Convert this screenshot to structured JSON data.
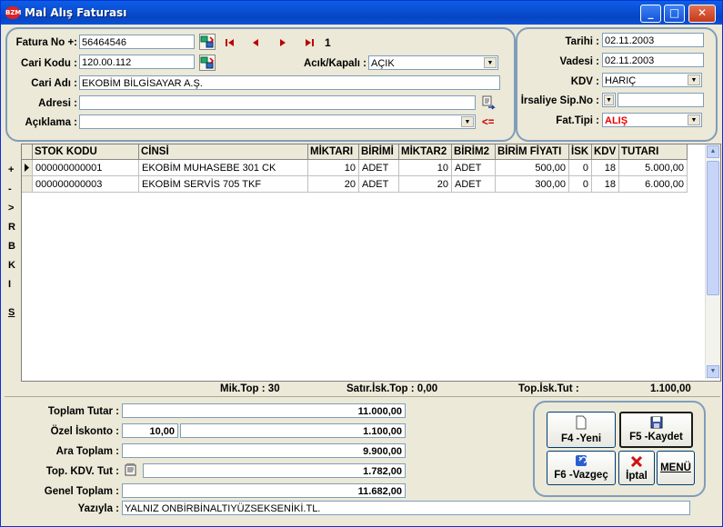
{
  "window": {
    "title": "Mal Alış Faturası",
    "logo_text": "BZM"
  },
  "header": {
    "fatura_no_label": "Fatura No +:",
    "fatura_no": "56464546",
    "nav_record": "1",
    "cari_kodu_label": "Cari Kodu :",
    "cari_kodu": "120.00.112",
    "acik_kapali_label": "Acık/Kapalı :",
    "acik_kapali": "AÇIK",
    "cari_adi_label": "Cari Adı :",
    "cari_adi": "EKOBİM BİLGİSAYAR A.Ş.",
    "adresi_label": "Adresi :",
    "adresi": "",
    "aciklama_label": "Açıklama :",
    "aciklama": "",
    "aciklama_arrow": "<="
  },
  "right_panel": {
    "tarihi_label": "Tarihi :",
    "tarihi": "02.11.2003",
    "vadesi_label": "Vadesi :",
    "vadesi": "02.11.2003",
    "kdv_label": "KDV :",
    "kdv": "HARIÇ",
    "irsaliye_label": "İrsaliye Sip.No :",
    "irsaliye": "",
    "fat_tipi_label": "Fat.Tipi :",
    "fat_tipi": "ALIŞ"
  },
  "side_buttons": [
    "+",
    "-",
    ">",
    "R",
    "B",
    "K",
    "I",
    "S"
  ],
  "table": {
    "columns": [
      "STOK KODU",
      "CİNSİ",
      "MİKTARI",
      "BİRİMİ",
      "MİKTAR2",
      "BİRİM2",
      "BİRİM FİYATI",
      "İSK",
      "KDV",
      "TUTARI"
    ],
    "rows": [
      [
        "000000000001",
        "EKOBİM MUHASEBE 301 CK",
        "10",
        "ADET",
        "10",
        "ADET",
        "500,00",
        "0",
        "18",
        "5.000,00"
      ],
      [
        "000000000003",
        "EKOBİM SERVİS 705 TKF",
        "20",
        "ADET",
        "20",
        "ADET",
        "300,00",
        "0",
        "18",
        "6.000,00"
      ]
    ]
  },
  "summary_line": {
    "mik_top": "Mik.Top : 30",
    "satir_isk_top": "Satır.İsk.Top : 0,00",
    "top_isk_tut_label": "Top.İsk.Tut :",
    "top_isk_tut_value": "1.100,00"
  },
  "totals": {
    "toplam_tutar_label": "Toplam Tutar :",
    "toplam_tutar": "11.000,00",
    "ozel_iskonto_label": "Özel İskonto :",
    "ozel_iskonto_pct": "10,00",
    "ozel_iskonto": "1.100,00",
    "ara_toplam_label": "Ara Toplam :",
    "ara_toplam": "9.900,00",
    "top_kdv_label": "Top. KDV. Tut :",
    "top_kdv": "1.782,00",
    "genel_toplam_label": "Genel Toplam :",
    "genel_toplam": "11.682,00",
    "yaziyla_label": "Yazıyla :",
    "yaziyla": "YALNIZ ONBİRBİNALTIYÜZSEKSENİKİ.TL."
  },
  "actions": {
    "yeni": "F4 -Yeni",
    "kaydet": "F5 -Kaydet",
    "vazgec": "F6 -Vazgeç",
    "iptal": "İptal",
    "menu": "MENÜ"
  }
}
